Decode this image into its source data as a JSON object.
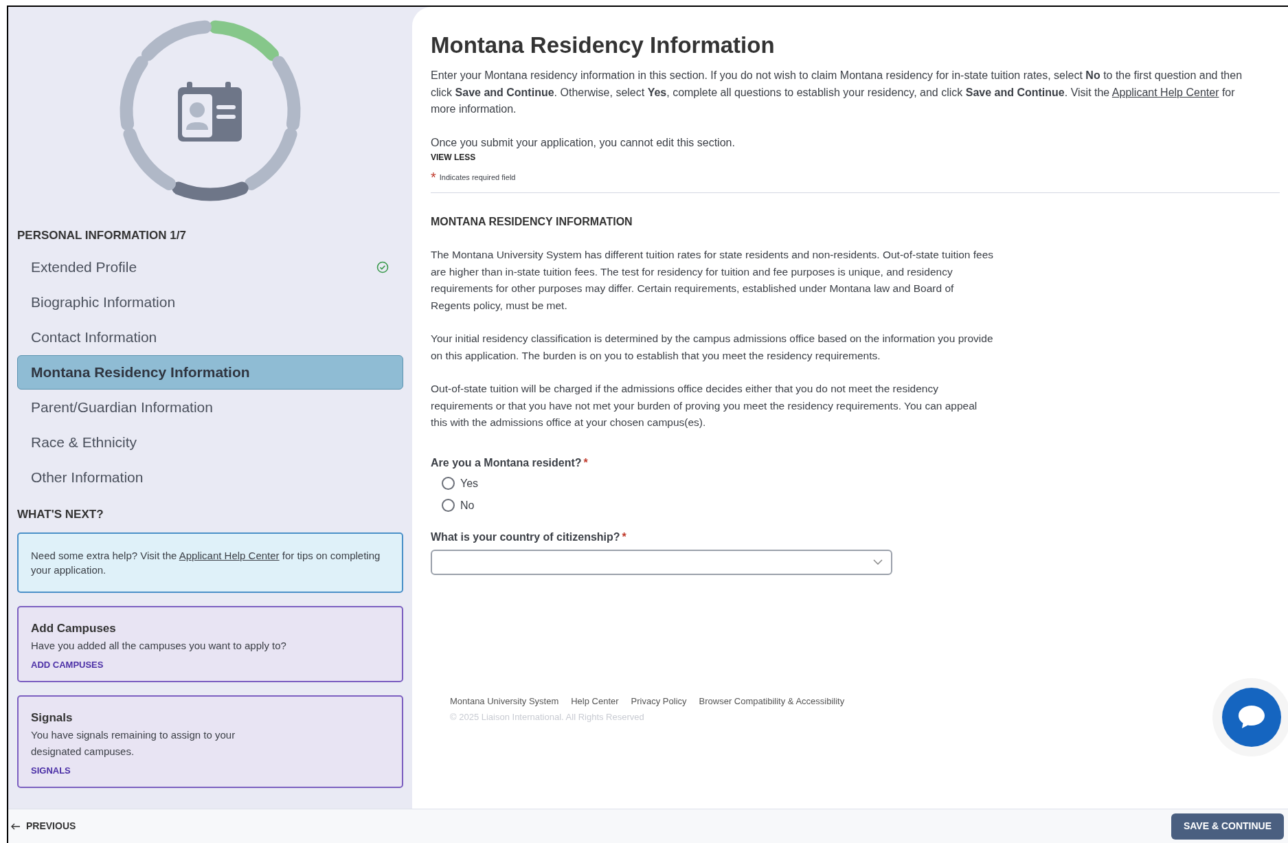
{
  "sidebar": {
    "section_heading": "PERSONAL INFORMATION 1/7",
    "items": [
      {
        "label": "Extended Profile",
        "completed": true,
        "selected": false
      },
      {
        "label": "Biographic Information",
        "completed": false,
        "selected": false
      },
      {
        "label": "Contact Information",
        "completed": false,
        "selected": false
      },
      {
        "label": "Montana Residency Information",
        "completed": false,
        "selected": true
      },
      {
        "label": "Parent/Guardian Information",
        "completed": false,
        "selected": false
      },
      {
        "label": "Race & Ethnicity",
        "completed": false,
        "selected": false
      },
      {
        "label": "Other Information",
        "completed": false,
        "selected": false
      }
    ],
    "whats_next_heading": "WHAT'S NEXT?",
    "help_card": {
      "text_before": "Need some extra help? Visit the ",
      "link": "Applicant Help Center",
      "text_after": " for tips on completing your application."
    },
    "cards": [
      {
        "title": "Add Campuses",
        "text": "Have you added all the campuses you want to apply to?",
        "link": "ADD CAMPUSES"
      },
      {
        "title": "Signals",
        "text": "You have signals remaining to assign to your designated campuses.",
        "link": "SIGNALS"
      }
    ]
  },
  "main": {
    "title": "Montana Residency Information",
    "intro_before": "Enter your Montana residency information in this section. If you do not wish to claim Montana residency for in-state tuition rates, select **No** to the first question and then click **Save and Continue**. Otherwise, select **Yes**, complete all questions to establish your residency, and click **Save and Continue**. Visit the ",
    "intro_link": "Applicant Help Center",
    "intro_after": " for more information.",
    "note": "Once you submit your application, you cannot edit this section.",
    "view_less": "VIEW LESS",
    "required_note": {
      "mark": "*",
      "text": "Indicates required field"
    },
    "section_heading": "MONTANA RESIDENCY INFORMATION",
    "paragraphs": [
      "The Montana University System has different tuition rates for state residents and non-residents. Out-of-state tuition fees are higher than in-state tuition fees. The test for residency for tuition and fee purposes is unique, and residency requirements for other purposes may differ. Certain requirements, established under Montana law and Board of Regents policy, must be met.",
      "Your initial residency classification is determined by the campus admissions office based on the information you provide on this application. The burden is on you to establish that you meet the residency requirements.",
      "Out-of-state tuition will be charged if the admissions office decides either that you do not meet the residency requirements or that you have not met your burden of proving you meet the residency requirements. You can appeal this with the admissions office at your chosen campus(es)."
    ],
    "questions": [
      {
        "kind": "radio",
        "label": "Are you a Montana resident?",
        "required_mark": "*",
        "options": [
          {
            "label": "Yes",
            "selected": false
          },
          {
            "label": "No",
            "selected": false
          }
        ]
      },
      {
        "kind": "select",
        "label": "What is your country of citizenship?",
        "required_mark": "*"
      }
    ]
  },
  "footer": {
    "links": [
      "Montana University System",
      "Help Center",
      "Privacy Policy",
      "Browser Compatibility & Accessibility"
    ],
    "copyright": "© 2025 Liaison International. All Rights Reserved"
  },
  "bottom_bar": {
    "previous": "PREVIOUS",
    "save": "SAVE & CONTINUE"
  }
}
